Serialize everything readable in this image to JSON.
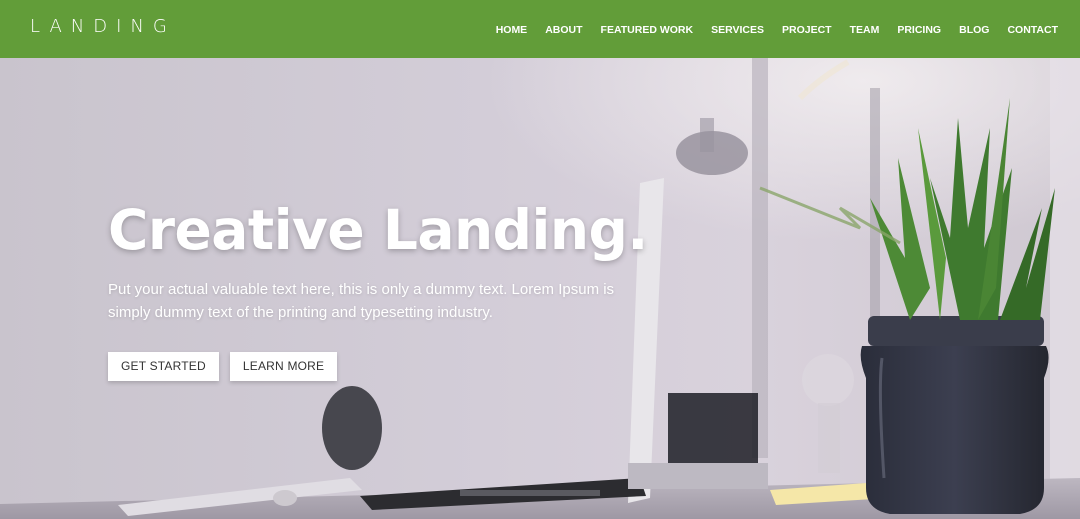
{
  "brand": {
    "logo": "LANDING"
  },
  "nav": {
    "items": [
      "HOME",
      "ABOUT",
      "FEATURED WORK",
      "SERVICES",
      "PROJECT",
      "TEAM",
      "PRICING",
      "BLOG",
      "CONTACT"
    ]
  },
  "hero": {
    "title": "Creative Landing.",
    "subtitle": "Put your actual valuable text here, this is only a dummy text. Lorem Ipsum is simply dummy text of the printing and typesetting industry.",
    "primary_button": "GET STARTED",
    "secondary_button": "LEARN MORE"
  },
  "colors": {
    "nav_background": "#629d39",
    "button_background": "#ffffff"
  }
}
